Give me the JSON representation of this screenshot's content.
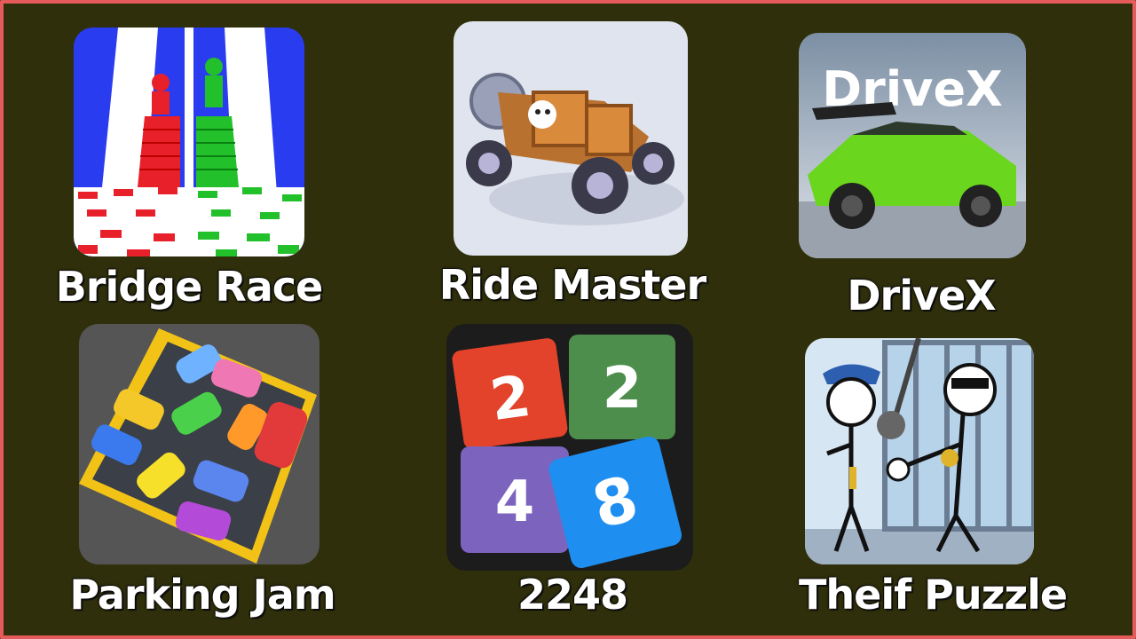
{
  "games": [
    {
      "label": "Bridge Race",
      "icon": "bridge-race-icon"
    },
    {
      "label": "Ride Master",
      "icon": "ride-master-icon"
    },
    {
      "label": "DriveX",
      "icon": "drivex-icon",
      "logo_text": "DriveX"
    },
    {
      "label": "Parking Jam",
      "icon": "parking-jam-icon"
    },
    {
      "label": "2248",
      "icon": "2248-icon",
      "tiles": [
        "2",
        "2",
        "4",
        "8"
      ]
    },
    {
      "label": "Theif Puzzle",
      "icon": "thief-puzzle-icon"
    }
  ],
  "colors": {
    "background": "#2f2f0b",
    "border": "#e55a5a"
  }
}
